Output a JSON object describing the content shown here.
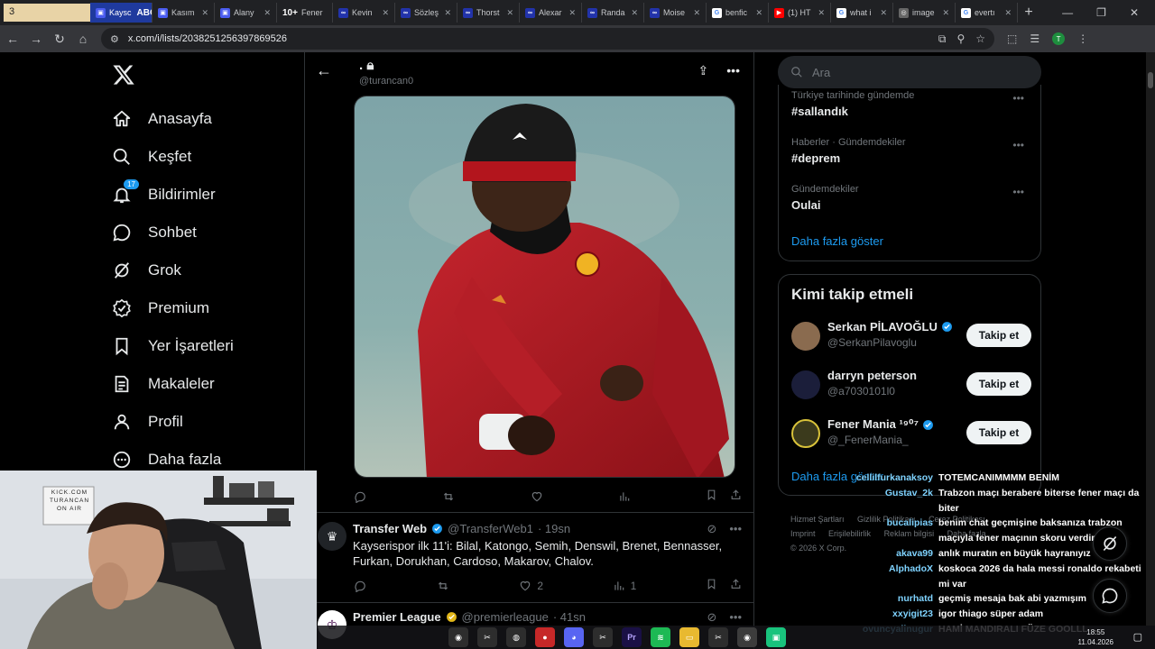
{
  "browser": {
    "first_tab": "3",
    "tabs": [
      {
        "label": "Kaysc",
        "fav": "#4a5cf0"
      },
      {
        "label": "Kasım",
        "fav": "#4a5cf0"
      },
      {
        "label": "Alany",
        "fav": "#4a5cf0"
      },
      {
        "label": "Fener",
        "fav": "#4a5cf0"
      },
      {
        "label": "Kevin",
        "fav": "#2233aa"
      },
      {
        "label": "Sözleş",
        "fav": "#2233aa"
      },
      {
        "label": "Thorst",
        "fav": "#2233aa"
      },
      {
        "label": "Alexar",
        "fav": "#2233aa"
      },
      {
        "label": "Randa",
        "fav": "#2233aa"
      },
      {
        "label": "Moise",
        "fav": "#2233aa"
      },
      {
        "label": "benfic",
        "fav": "#ffffff"
      },
      {
        "label": "(1) HT",
        "fav": "#ff0000"
      },
      {
        "label": "what i",
        "fav": "#ffffff"
      },
      {
        "label": "image",
        "fav": "#888888"
      },
      {
        "label": "evertı",
        "fav": "#ffffff"
      }
    ],
    "overlay_abone": "ABONE",
    "overlay_count": "10+",
    "url": "x.com/i/lists/2038251256397869526",
    "profile_initial": "T"
  },
  "nav": {
    "items": [
      {
        "label": "Anasayfa",
        "icon": "home-icon"
      },
      {
        "label": "Keşfet",
        "icon": "search-icon"
      },
      {
        "label": "Bildirimler",
        "icon": "bell-icon",
        "badge": "17"
      },
      {
        "label": "Sohbet",
        "icon": "chat-icon"
      },
      {
        "label": "Grok",
        "icon": "grok-icon"
      },
      {
        "label": "Premium",
        "icon": "premium-icon"
      },
      {
        "label": "Yer İşaretleri",
        "icon": "bookmark-icon"
      },
      {
        "label": "Makaleler",
        "icon": "article-icon"
      },
      {
        "label": "Profil",
        "icon": "profile-icon"
      },
      {
        "label": "Daha fazla",
        "icon": "more-icon"
      }
    ]
  },
  "header": {
    "name": ".",
    "handle": "@turancan0"
  },
  "post_actions": {
    "views": ""
  },
  "tweets": [
    {
      "name": "Transfer Web",
      "handle": "@TransferWeb1",
      "time": "· 19sn",
      "text": "Kayserispor ilk 11'i: Bilal, Katongo, Semih, Denswil, Brenet, Bennasser, Furkan, Dorukhan, Cardoso, Makarov, Chalov.",
      "likes": "2",
      "views": "1",
      "verified_color": "#1d9bf0"
    },
    {
      "name": "Premier League",
      "handle": "@premierleague",
      "time": "· 41sn",
      "verified_color": "#e2b719"
    }
  ],
  "search": {
    "placeholder": "Ara"
  },
  "trends": [
    {
      "category": "Türkiye tarihinde gündemde",
      "name": "#sallandık"
    },
    {
      "category": "Haberler · Gündemdekiler",
      "name": "#deprem"
    },
    {
      "category": "Gündemdekiler",
      "name": "Oulai"
    }
  ],
  "trends_more": "Daha fazla göster",
  "who_to_follow": {
    "title": "Kimi takip etmeli",
    "people": [
      {
        "name": "Serkan PİLAVOĞLU",
        "handle": "@SerkanPilavoglu",
        "verified": true,
        "button": "Takip et"
      },
      {
        "name": "darryn peterson",
        "handle": "@a7030101l0",
        "verified": false,
        "button": "Takip et"
      },
      {
        "name": "Fener Mania ¹⁹⁰⁷",
        "handle": "@_FenerMania_",
        "verified": true,
        "button": "Takip et"
      }
    ],
    "more": "Daha fazla göster"
  },
  "footer": {
    "links": [
      "Hizmet Şartları",
      "Gizlilik Politikası",
      "Çerez Politikası",
      "Imprint",
      "Erişilebilirlik",
      "Reklam bilgisi",
      "Daha fazla ...",
      "© 2026 X Corp."
    ]
  },
  "webcam": {
    "sign_lines": [
      "KICK.COM",
      "TURANCAN",
      "ON AIR"
    ]
  },
  "chat": [
    {
      "user": "cellilfurkanaksoy",
      "msg": "TOTEMCANIMMMM BENİM"
    },
    {
      "user": "Gustav_2k",
      "msg": "Trabzon maçı berabere biterse fener maçı da biter"
    },
    {
      "user": "bucalipias",
      "msg": "benim chat geçmişine baksanıza trabzon maçıyla fener maçının skoru verdim"
    },
    {
      "user": "akava99",
      "msg": "anlık muratın en büyük hayranıyız"
    },
    {
      "user": "AlphadoX",
      "msg": "koskoca 2026 da hala messi ronaldo rekabeti mi var"
    },
    {
      "user": "nurhatd",
      "msg": "geçmiş mesaja bak abi yazmışım"
    },
    {
      "user": "xxyigit23",
      "msg": "igor thiago süper adam"
    },
    {
      "user": "ovuncyalinugur",
      "msg": "HAMİ MANDIRALI FÜZE GOOLLL"
    }
  ],
  "taskbar": {
    "time": "18:55",
    "date": "11.04.2026",
    "icons": [
      "chrome",
      "capcut",
      "obs",
      "record",
      "discord",
      "capcut2",
      "premiere",
      "spotify",
      "files",
      "capcut3",
      "chrome2",
      "green-app"
    ]
  },
  "colors": {
    "accent": "#1d9bf0",
    "bg": "#000000",
    "border": "#2f3336",
    "muted": "#71767b"
  }
}
